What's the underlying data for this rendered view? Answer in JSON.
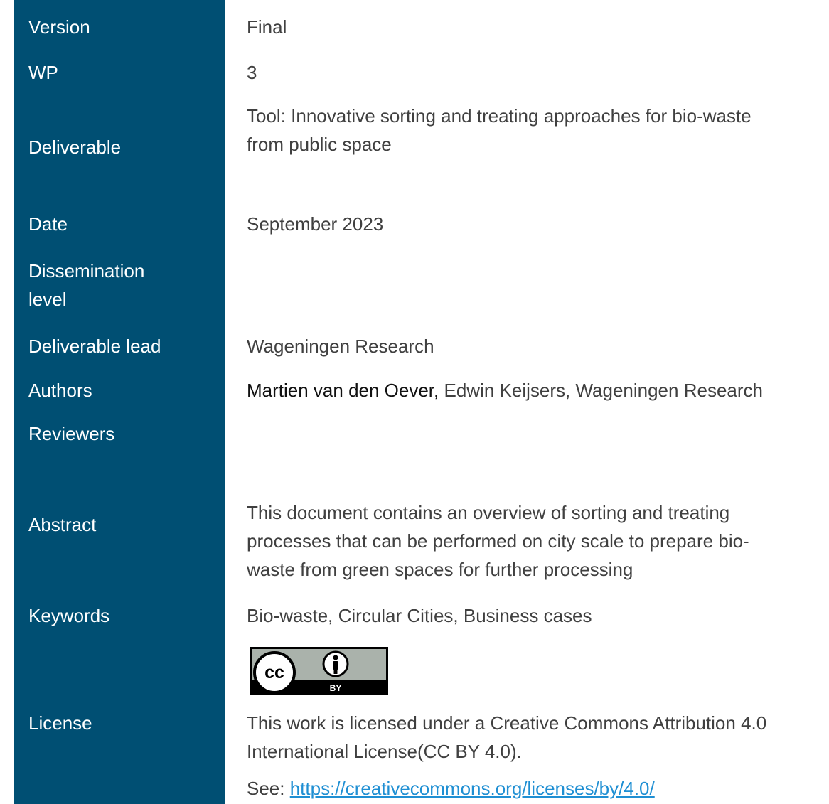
{
  "labels": {
    "version": "Version",
    "wp": "WP",
    "deliverable": "Deliverable",
    "date": "Date",
    "dissemination_line1": "Dissemination",
    "dissemination_line2": "level",
    "deliverable_lead": "Deliverable lead",
    "authors": "Authors",
    "reviewers": "Reviewers",
    "abstract": "Abstract",
    "keywords": "Keywords",
    "license": "License"
  },
  "values": {
    "version": "Final",
    "wp": "3",
    "deliverable_line1": "Tool: Innovative sorting and treating approaches for bio-waste",
    "deliverable_line2": "from public space",
    "date": "September 2023",
    "deliverable_lead": "Wageningen Research",
    "authors_primary": "Martien van den Oever,",
    "authors_rest": " Edwin Keijsers, Wageningen Research",
    "abstract_line1": "This document contains an overview of sorting and treating",
    "abstract_line2": "processes that can be performed on city scale to prepare bio-",
    "abstract_line3": "waste from green spaces for further processing",
    "keywords": "Bio-waste, Circular Cities, Business cases",
    "license_line1": "This work is licensed under a Creative Commons Attribution 4.0",
    "license_line2": "International License(CC BY 4.0).",
    "see_prefix": "See: ",
    "license_url": "https://creativecommons.org/licenses/by/4.0/"
  },
  "cc_badge": {
    "cc_text": "cc",
    "by_text": "BY",
    "icons": [
      "cc-icon",
      "person-icon"
    ]
  },
  "colors": {
    "sidebar": "#004f73",
    "link": "#1f8fd3"
  }
}
